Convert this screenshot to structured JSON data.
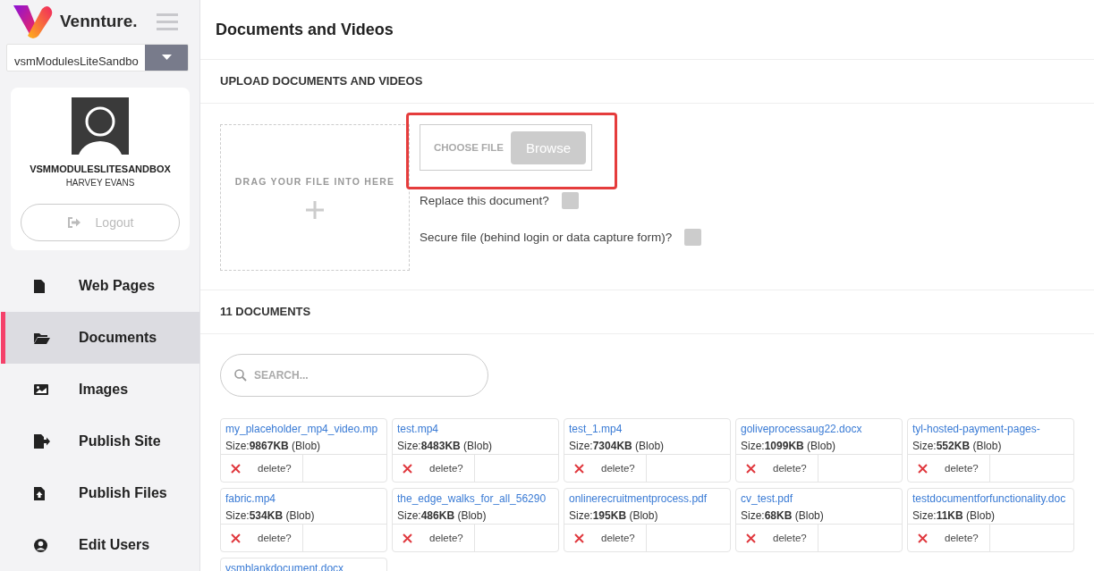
{
  "brand": {
    "name": "Vennture."
  },
  "site_select": {
    "value": "vsmModulesLiteSandbo"
  },
  "profile": {
    "site": "VSMMODULESLITESANDBOX",
    "user": "HARVEY EVANS",
    "logout": "Logout"
  },
  "nav": [
    {
      "label": "Web Pages",
      "selected": false
    },
    {
      "label": "Documents",
      "selected": true
    },
    {
      "label": "Images",
      "selected": false
    },
    {
      "label": "Publish Site",
      "selected": false
    },
    {
      "label": "Publish Files",
      "selected": false
    },
    {
      "label": "Edit Users",
      "selected": false
    }
  ],
  "page_title": "Documents and Videos",
  "upload": {
    "heading": "UPLOAD DOCUMENTS AND VIDEOS",
    "drop_zone": "DRAG YOUR FILE INTO HERE",
    "file_field": {
      "placeholder": "CHOOSE FILE",
      "button": "Browse"
    },
    "options": [
      {
        "label": "Replace this document?",
        "checked": false
      },
      {
        "label": "Secure file (behind login or data capture form)?",
        "checked": false
      }
    ]
  },
  "documents": {
    "heading": "11 DOCUMENTS",
    "search": {
      "placeholder": "SEARCH..."
    },
    "items": [
      {
        "name": "my_placeholder_mp4_video.mp",
        "size": "Size:**9867KB** (Blob)",
        "delete": "delete?"
      },
      {
        "name": "test.mp4",
        "size": "Size:**8483KB** (Blob)",
        "delete": "delete?"
      },
      {
        "name": "test_1.mp4",
        "size": "Size:**7304KB** (Blob)",
        "delete": "delete?"
      },
      {
        "name": "goliveprocessaug22.docx",
        "size": "Size:**1099KB** (Blob)",
        "delete": "delete?"
      },
      {
        "name": "tyl-hosted-payment-pages-",
        "size": "Size:**552KB** (Blob)",
        "delete": "delete?"
      },
      {
        "name": "fabric.mp4",
        "size": "Size:**534KB** (Blob)",
        "delete": "delete?"
      },
      {
        "name": "the_edge_walks_for_all_56290",
        "size": "Size:**486KB** (Blob)",
        "delete": "delete?"
      },
      {
        "name": "onlinerecruitmentprocess.pdf",
        "size": "Size:**195KB** (Blob)",
        "delete": "delete?"
      },
      {
        "name": "cv_test.pdf",
        "size": "Size:**68KB** (Blob)",
        "delete": "delete?"
      },
      {
        "name": "testdocumentforfunctionality.doc",
        "size": "Size:**11KB** (Blob)",
        "delete": "delete?"
      },
      {
        "name": "vsmblankdocument.docx"
      }
    ]
  }
}
